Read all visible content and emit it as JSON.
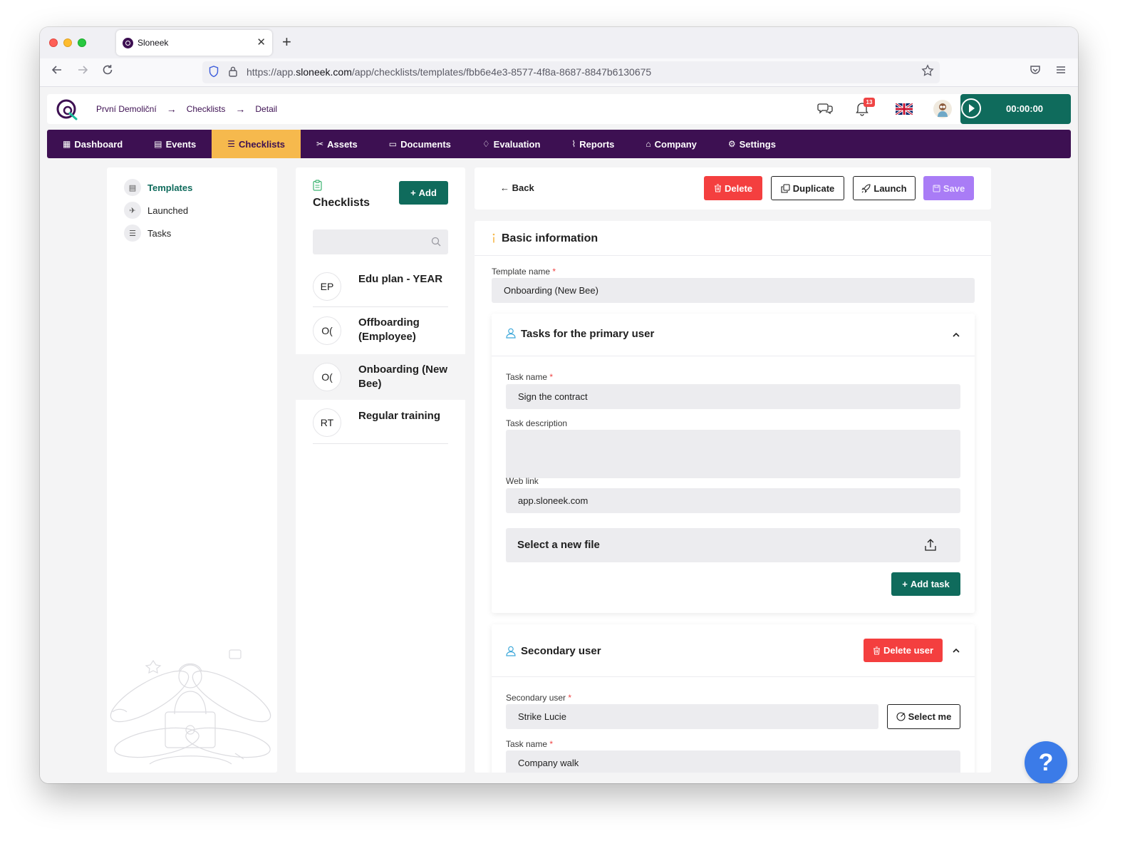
{
  "browser": {
    "tab_title": "Sloneek",
    "tab_close": "✕",
    "new_tab": "+",
    "url_prefix": "https://app.",
    "url_host": "sloneek.com",
    "url_path": "/app/checklists/templates/fbb6e4e3-8577-4f8a-8687-8847b6130675"
  },
  "topbar": {
    "breadcrumbs": [
      "První Demoliční",
      "Checklists",
      "Detail"
    ],
    "crumb_arrow": "→",
    "notification_count": "13",
    "timer": "00:00:00"
  },
  "menu": [
    {
      "icon": "▦",
      "label": "Dashboard"
    },
    {
      "icon": "▤",
      "label": "Events"
    },
    {
      "icon": "☰",
      "label": "Checklists"
    },
    {
      "icon": "✂",
      "label": "Assets"
    },
    {
      "icon": "▭",
      "label": "Documents"
    },
    {
      "icon": "♢",
      "label": "Evaluation"
    },
    {
      "icon": "⌇",
      "label": "Reports"
    },
    {
      "icon": "⌂",
      "label": "Company"
    },
    {
      "icon": "⚙",
      "label": "Settings"
    }
  ],
  "active_menu": "Checklists",
  "sidebar": {
    "items": [
      {
        "icon": "▤",
        "label": "Templates"
      },
      {
        "icon": "✈",
        "label": "Launched"
      },
      {
        "icon": "☰",
        "label": "Tasks"
      }
    ],
    "active": "Templates"
  },
  "checklists": {
    "title": "Checklists",
    "add_label": "Add",
    "search_placeholder": "",
    "items": [
      {
        "initials": "EP",
        "name": "Edu plan - YEAR"
      },
      {
        "initials": "O(",
        "name": "Offboarding (Employee)"
      },
      {
        "initials": "O(",
        "name": "Onboarding (New Bee)"
      },
      {
        "initials": "RT",
        "name": "Regular training"
      }
    ],
    "selected": "Onboarding (New Bee)"
  },
  "actions": {
    "back": "Back",
    "delete": "Delete",
    "duplicate": "Duplicate",
    "launch": "Launch",
    "save": "Save"
  },
  "basic": {
    "title": "Basic information",
    "template_name_label": "Template name",
    "template_name_value": "Onboarding (New Bee)"
  },
  "primary": {
    "title": "Tasks for the primary user",
    "task_name_label": "Task name",
    "task_name_value": "Sign the contract",
    "task_desc_label": "Task description",
    "task_desc_value": "",
    "web_link_label": "Web link",
    "web_link_value": "app.sloneek.com",
    "file_label": "Select a new file",
    "add_task": "Add task"
  },
  "secondary": {
    "title": "Secondary user",
    "delete_user": "Delete user",
    "user_label": "Secondary user",
    "user_value": "Strike Lucie",
    "select_me": "Select me",
    "task_name_label": "Task name",
    "task_name_value": "Company walk"
  },
  "required_mark": "*",
  "help_label": "?",
  "colors": {
    "brand_purple": "#3d1052",
    "active_tab": "#f6b94d",
    "primary_green": "#0f6b5c",
    "danger_red": "#f43f3f",
    "save_violet": "#a97cf6",
    "help_blue": "#3b7be8"
  }
}
